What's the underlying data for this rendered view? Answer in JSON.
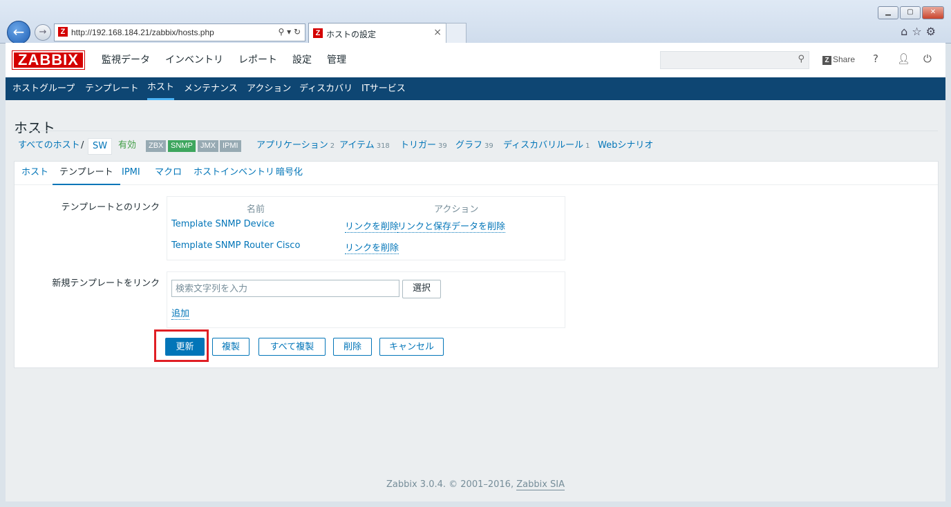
{
  "browser": {
    "url": "http://192.168.184.21/zabbix/hosts.php",
    "tab_title": "ホストの設定",
    "favicon": "Z"
  },
  "header": {
    "logo": "ZABBIX",
    "menu": [
      "監視データ",
      "インベントリ",
      "レポート",
      "設定",
      "管理"
    ],
    "share_label": "Share",
    "help_label": "?"
  },
  "subnav": [
    "ホストグループ",
    "テンプレート",
    "ホスト",
    "メンテナンス",
    "アクション",
    "ディスカバリ",
    "ITサービス"
  ],
  "page_title": "ホスト",
  "host_bar": {
    "all_hosts": "すべてのホスト",
    "separator": "/",
    "host_name": "SW",
    "status": "有効",
    "availability": [
      "ZBX",
      "SNMP",
      "JMX",
      "IPMI"
    ],
    "links": [
      {
        "label": "アプリケーション",
        "count": "2"
      },
      {
        "label": "アイテム",
        "count": "318"
      },
      {
        "label": "トリガー",
        "count": "39"
      },
      {
        "label": "グラフ",
        "count": "39"
      },
      {
        "label": "ディスカバリルール",
        "count": "1"
      },
      {
        "label": "Webシナリオ",
        "count": ""
      }
    ]
  },
  "tabs": [
    "ホスト",
    "テンプレート",
    "IPMI",
    "マクロ",
    "ホストインベントリ",
    "暗号化"
  ],
  "linked_templates": {
    "label": "テンプレートとのリンク",
    "col_name": "名前",
    "col_action": "アクション",
    "rows": [
      {
        "name": "Template SNMP Device",
        "unlink": "リンクを削除",
        "unlink_clear": "リンクと保存データを削除"
      },
      {
        "name": "Template SNMP Router Cisco",
        "unlink": "リンクを削除",
        "unlink_clear": ""
      }
    ]
  },
  "new_template": {
    "label": "新規テンプレートをリンク",
    "placeholder": "検索文字列を入力",
    "select_label": "選択",
    "add_label": "追加"
  },
  "buttons": {
    "update": "更新",
    "clone": "複製",
    "full_clone": "すべて複製",
    "delete": "削除",
    "cancel": "キャンセル"
  },
  "footer": {
    "text": "Zabbix 3.0.4. © 2001–2016,",
    "company": "Zabbix SIA"
  },
  "colors": {
    "subnav_bg": "#0e4673",
    "accent": "#0275b8",
    "status_green": "#429e47",
    "snmp_green": "#59db8f",
    "gray_badge": "#97aab3",
    "highlight": "#e01e24"
  }
}
